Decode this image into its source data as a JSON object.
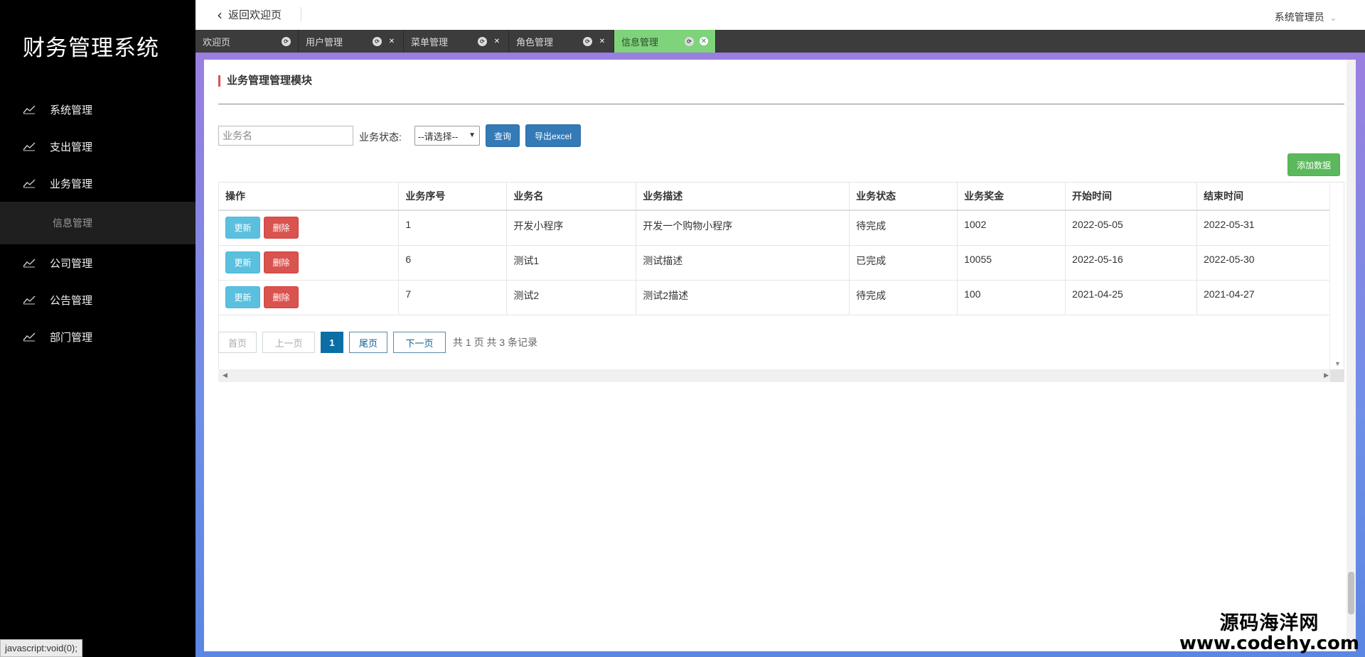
{
  "app": {
    "title": "财务管理系统"
  },
  "sidebar": {
    "items": [
      {
        "label": "系统管理",
        "icon": "chart-line-icon"
      },
      {
        "label": "支出管理",
        "icon": "chart-line-icon"
      },
      {
        "label": "业务管理",
        "icon": "chart-line-icon"
      },
      {
        "label": "公司管理",
        "icon": "chart-line-icon"
      },
      {
        "label": "公告管理",
        "icon": "chart-line-icon"
      },
      {
        "label": "部门管理",
        "icon": "chart-line-icon"
      }
    ],
    "sub_item": {
      "label": "信息管理"
    }
  },
  "header": {
    "back_label": "返回欢迎页",
    "user_label": "系统管理员"
  },
  "tabs": [
    {
      "label": "欢迎页",
      "closable": false,
      "active": false
    },
    {
      "label": "用户管理",
      "closable": true,
      "active": false
    },
    {
      "label": "菜单管理",
      "closable": true,
      "active": false
    },
    {
      "label": "角色管理",
      "closable": true,
      "active": false
    },
    {
      "label": "信息管理",
      "closable": true,
      "active": true
    }
  ],
  "main": {
    "section_title": "业务管理管理模块",
    "search": {
      "placeholder": "业务名",
      "value": ""
    },
    "status_label": "业务状态:",
    "status_select": {
      "selected": "--请选择--"
    },
    "query_label": "查询",
    "export_label": "导出excel",
    "add_label": "添加数据"
  },
  "table": {
    "columns": [
      "操作",
      "业务序号",
      "业务名",
      "业务描述",
      "业务状态",
      "业务奖金",
      "开始时间",
      "结束时间"
    ],
    "update_label": "更新",
    "delete_label": "删除",
    "rows": [
      {
        "id": "1",
        "name": "开发小程序",
        "desc": "开发一个购物小程序",
        "status": "待完成",
        "bonus": "1002",
        "start": "2022-05-05",
        "end": "2022-05-31"
      },
      {
        "id": "6",
        "name": "测试1",
        "desc": "测试描述",
        "status": "已完成",
        "bonus": "10055",
        "start": "2022-05-16",
        "end": "2022-05-30"
      },
      {
        "id": "7",
        "name": "测试2",
        "desc": "测试2描述",
        "status": "待完成",
        "bonus": "100",
        "start": "2021-04-25",
        "end": "2021-04-27"
      }
    ]
  },
  "pagination": {
    "first": "首页",
    "prev": "上一页",
    "current": "1",
    "last": "尾页",
    "next": "下一页",
    "info": "共 1 页 共 3 条记录"
  },
  "statusbar": {
    "text": "javascript:void(0);"
  },
  "watermark": {
    "line1": "源码海洋网",
    "line2": "www.codehy.com"
  },
  "colors": {
    "sidebar_bg": "#000000",
    "active_tab": "#7fd37b",
    "primary": "#337ab7",
    "success": "#5cb85c",
    "info": "#5bc0de",
    "danger": "#d9534f"
  }
}
